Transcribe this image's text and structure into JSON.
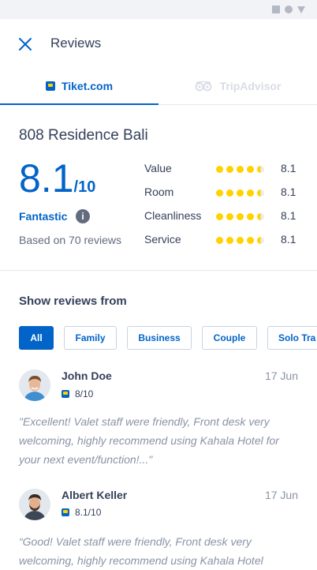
{
  "header": {
    "title": "Reviews"
  },
  "tabs": [
    {
      "label": "Tiket.com",
      "active": true
    },
    {
      "label": "TripAdvisor",
      "active": false
    }
  ],
  "hotel": {
    "name": "808 Residence Bali",
    "score": "8.1",
    "score_max": "/10",
    "rating_word": "Fantastic",
    "info_glyph": "i",
    "based_on": "Based on 70 reviews"
  },
  "breakdown": [
    {
      "label": "Value",
      "value": "8.1",
      "stars": 4.5
    },
    {
      "label": "Room",
      "value": "8.1",
      "stars": 4.5
    },
    {
      "label": "Cleanliness",
      "value": "8.1",
      "stars": 4.5
    },
    {
      "label": "Service",
      "value": "8.1",
      "stars": 4.5
    }
  ],
  "filter": {
    "title": "Show reviews from",
    "chips": [
      "All",
      "Family",
      "Business",
      "Couple",
      "Solo Tra"
    ],
    "active": "All"
  },
  "reviews": [
    {
      "name": "John Doe",
      "date": "17 Jun",
      "score": "8/10",
      "text": "\"Excellent! Valet staff were friendly, Front desk very welcoming, highly recommend using Kahala Hotel for your next event/function!...\""
    },
    {
      "name": "Albert Keller",
      "date": "17 Jun",
      "score": "8.1/10",
      "text": "“Good! Valet staff were friendly, Front desk very welcoming, highly recommend using Kahala Hotel"
    }
  ],
  "colors": {
    "primary": "#0264c8",
    "star": "#ffd200",
    "text": "#35405a",
    "muted": "#8a93a6"
  },
  "icons": {
    "close": "close-icon",
    "info": "info-icon",
    "tiket": "tiket-logo-icon",
    "tripadvisor": "tripadvisor-logo-icon"
  }
}
